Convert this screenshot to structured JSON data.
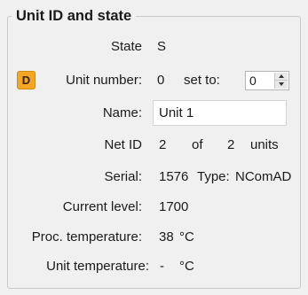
{
  "group": {
    "title": "Unit ID and state"
  },
  "state": {
    "label": "State",
    "value": "S"
  },
  "unit_number": {
    "badge": "D",
    "label": "Unit number:",
    "value": "0",
    "set_to_label": "set to:",
    "set_to_value": "0"
  },
  "name": {
    "label": "Name:",
    "value": "Unit 1"
  },
  "net_id": {
    "label": "Net ID",
    "value": "2",
    "of_label": "of",
    "total": "2",
    "units_label": "units"
  },
  "serial": {
    "label": "Serial:",
    "value": "1576",
    "type_label": "Type:",
    "type_value": "NComAD"
  },
  "current_level": {
    "label": "Current level:",
    "value": "1700"
  },
  "proc_temperature": {
    "label": "Proc. temperature:",
    "value": "38",
    "unit": "°C"
  },
  "unit_temperature": {
    "label": "Unit temperature:",
    "value": "-",
    "unit": "°C"
  },
  "colors": {
    "badge": "#f5a623",
    "background": "#f0f0f0"
  }
}
